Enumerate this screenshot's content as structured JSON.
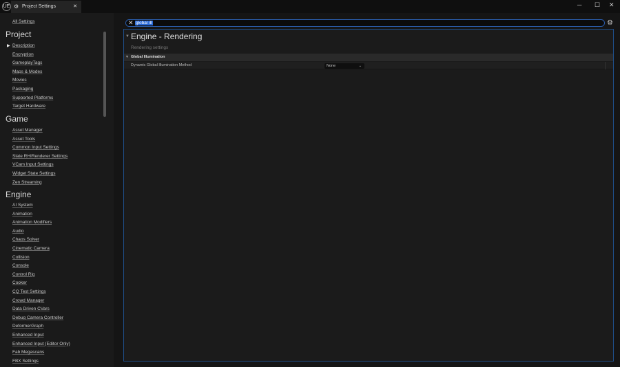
{
  "window": {
    "tab_title": "Project Settings",
    "logo": "UE",
    "controls": {
      "minimize": "─",
      "maximize": "☐",
      "close": "✕"
    }
  },
  "sidebar": {
    "all_settings": "All Settings",
    "sections": [
      {
        "title": "Project",
        "items": [
          "Description",
          "Encryption",
          "GameplayTags",
          "Maps & Modes",
          "Movies",
          "Packaging",
          "Supported Platforms",
          "Target Hardware"
        ]
      },
      {
        "title": "Game",
        "items": [
          "Asset Manager",
          "Asset Tools",
          "Common Input Settings",
          "Slate RHIRenderer Settings",
          "VCam Input Settings",
          "Widget State Settings",
          "Zen Streaming"
        ]
      },
      {
        "title": "Engine",
        "items": [
          "AI System",
          "Animation",
          "Animation Modifiers",
          "Audio",
          "Chaos Solver",
          "Cinematic Camera",
          "Collision",
          "Console",
          "Control Rig",
          "Cooker",
          "CQ Test Settings",
          "Crowd Manager",
          "Data Driven CVars",
          "Debug Camera Controller",
          "DeformerGraph",
          "Enhanced Input",
          "Enhanced Input (Editor Only)",
          "Fab Megascans",
          "FBX Settings"
        ]
      }
    ]
  },
  "search": {
    "value": "global ill"
  },
  "panel": {
    "title": "Engine - Rendering",
    "subtitle": "Rendering settings",
    "category": "Global Illumination",
    "rows": [
      {
        "label": "Dynamic Global Illumination Method",
        "value": "None"
      }
    ]
  }
}
